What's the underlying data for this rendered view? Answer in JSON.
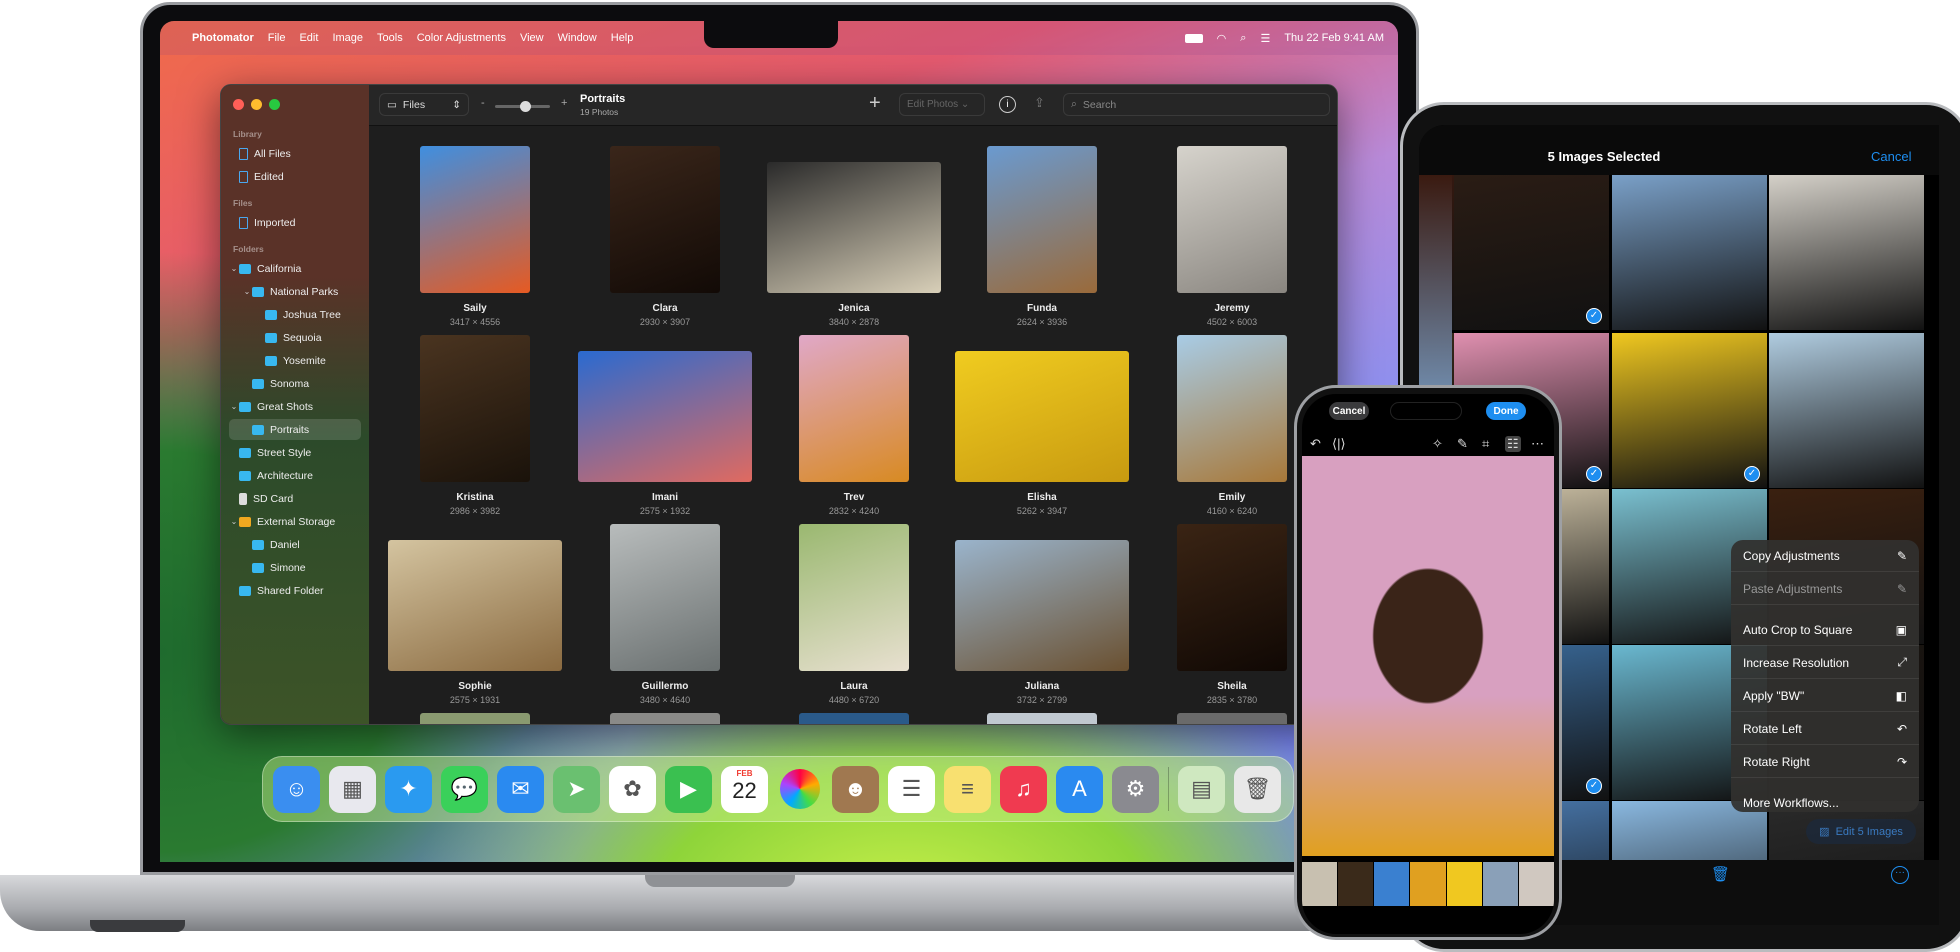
{
  "menubar": {
    "apple": "",
    "items": [
      "Photomator",
      "File",
      "Edit",
      "Image",
      "Tools",
      "Color Adjustments",
      "View",
      "Window",
      "Help"
    ],
    "datetime": "Thu 22 Feb  9:41 AM",
    "status_icons": [
      "battery-icon",
      "wifi-icon",
      "spotlight-search-icon",
      "control-center-icon"
    ]
  },
  "window": {
    "toolbar": {
      "source_select": "Files",
      "zoom_minus": "-",
      "zoom_plus": "+",
      "zoom_level": 0.55,
      "title": "Portraits",
      "subtitle": "19 Photos",
      "add": "+",
      "edit_photos": "Edit Photos ⌄",
      "search_placeholder": "Search"
    },
    "sidebar": {
      "sections": [
        {
          "header": "Library",
          "items": [
            {
              "label": "All Files",
              "icon": "doc",
              "level": 0
            },
            {
              "label": "Edited",
              "icon": "doc",
              "level": 0
            }
          ]
        },
        {
          "header": "Files",
          "items": [
            {
              "label": "Imported",
              "icon": "doc",
              "level": 0
            }
          ]
        },
        {
          "header": "Folders",
          "items": [
            {
              "label": "California",
              "icon": "folder",
              "level": 0,
              "chevron": "⌄"
            },
            {
              "label": "National Parks",
              "icon": "folder",
              "level": 1,
              "chevron": "⌄"
            },
            {
              "label": "Joshua Tree",
              "icon": "folder",
              "level": 2
            },
            {
              "label": "Sequoia",
              "icon": "folder",
              "level": 2
            },
            {
              "label": "Yosemite",
              "icon": "folder",
              "level": 2
            },
            {
              "label": "Sonoma",
              "icon": "folder",
              "level": 1
            },
            {
              "label": "Great Shots",
              "icon": "folder",
              "level": 0,
              "chevron": "⌄"
            },
            {
              "label": "Portraits",
              "icon": "folder",
              "level": 1,
              "selected": true
            },
            {
              "label": "Street Style",
              "icon": "folder",
              "level": 0
            },
            {
              "label": "Architecture",
              "icon": "folder",
              "level": 0
            },
            {
              "label": "SD Card",
              "icon": "card",
              "level": 0
            },
            {
              "label": "External Storage",
              "icon": "drive",
              "level": 0,
              "chevron": "⌄"
            },
            {
              "label": "Daniel",
              "icon": "folder",
              "level": 1
            },
            {
              "label": "Simone",
              "icon": "folder",
              "level": 1
            },
            {
              "label": "Shared Folder",
              "icon": "folder",
              "level": 0
            }
          ]
        }
      ]
    },
    "photos": [
      {
        "name": "Saily",
        "dims": "3417 × 4556",
        "colors": [
          "#3f8fe0",
          "#e65a22"
        ],
        "orient": "portrait"
      },
      {
        "name": "Clara",
        "dims": "2930 × 3907",
        "colors": [
          "#3a261a",
          "#120a06"
        ],
        "orient": "portrait"
      },
      {
        "name": "Jenica",
        "dims": "3840 × 2878",
        "colors": [
          "#2a2a2a",
          "#d8cfb8"
        ],
        "orient": "landscape"
      },
      {
        "name": "Funda",
        "dims": "2624 × 3936",
        "colors": [
          "#6a9ad0",
          "#9a6a3a"
        ],
        "orient": "portrait"
      },
      {
        "name": "Jeremy",
        "dims": "4502 × 6003",
        "colors": [
          "#d6d3cc",
          "#8a8680"
        ],
        "orient": "portrait"
      },
      {
        "name": "Kristina",
        "dims": "2986 × 3982",
        "colors": [
          "#4a3420",
          "#1a120a"
        ],
        "orient": "portrait"
      },
      {
        "name": "Imani",
        "dims": "2575 × 1932",
        "colors": [
          "#2a6ad0",
          "#e06a60"
        ],
        "orient": "landscape"
      },
      {
        "name": "Trev",
        "dims": "2832 × 4240",
        "colors": [
          "#e0a8c8",
          "#d88a22"
        ],
        "orient": "portrait"
      },
      {
        "name": "Elisha",
        "dims": "5262 × 3947",
        "colors": [
          "#f0cc20",
          "#c89a10"
        ],
        "orient": "landscape"
      },
      {
        "name": "Emily",
        "dims": "4160 × 6240",
        "colors": [
          "#a8cce6",
          "#a87838"
        ],
        "orient": "portrait"
      },
      {
        "name": "Sophie",
        "dims": "2575 × 1931",
        "colors": [
          "#d4c4a0",
          "#8a6a40"
        ],
        "orient": "landscape"
      },
      {
        "name": "Guillermo",
        "dims": "3480 × 4640",
        "colors": [
          "#b8bcbc",
          "#6a7070"
        ],
        "orient": "portrait"
      },
      {
        "name": "Laura",
        "dims": "4480 × 6720",
        "colors": [
          "#9ab870",
          "#e8e0d0"
        ],
        "orient": "portrait"
      },
      {
        "name": "Juliana",
        "dims": "3732 × 2799",
        "colors": [
          "#9ab4cc",
          "#6a5030"
        ],
        "orient": "landscape"
      },
      {
        "name": "Sheila",
        "dims": "2835 × 3780",
        "colors": [
          "#3a2414",
          "#100804"
        ],
        "orient": "portrait"
      }
    ],
    "partial_row_colors": [
      "#8a9a70",
      "#8a8a88",
      "#2a5a8a",
      "#c0c8d0",
      "#6a6a6a"
    ]
  },
  "dock": {
    "apps": [
      {
        "name": "finder",
        "glyph": "☺",
        "bg": "#3a8ef0"
      },
      {
        "name": "launchpad",
        "glyph": "▦",
        "bg": "#e8e8ee"
      },
      {
        "name": "safari",
        "glyph": "✦",
        "bg": "#2a9af0"
      },
      {
        "name": "messages",
        "glyph": "💬",
        "bg": "#3ad05a"
      },
      {
        "name": "mail",
        "glyph": "✉",
        "bg": "#2a8af0"
      },
      {
        "name": "maps",
        "glyph": "➤",
        "bg": "#6ac070"
      },
      {
        "name": "photos",
        "glyph": "✿",
        "bg": "#ffffff"
      },
      {
        "name": "facetime",
        "glyph": "▶",
        "bg": "#3ac050"
      },
      {
        "name": "calendar",
        "glyph": "",
        "bg": "#ffffff"
      },
      {
        "name": "photomator",
        "glyph": "●",
        "bg": "#2a2a2a"
      },
      {
        "name": "contacts",
        "glyph": "☻",
        "bg": "#a07850"
      },
      {
        "name": "reminders",
        "glyph": "☰",
        "bg": "#ffffff"
      },
      {
        "name": "notes",
        "glyph": "≡",
        "bg": "#f8e070"
      },
      {
        "name": "music",
        "glyph": "♫",
        "bg": "#f03a50"
      },
      {
        "name": "app-store",
        "glyph": "A",
        "bg": "#2a8af0"
      },
      {
        "name": "system-settings",
        "glyph": "⚙",
        "bg": "#8a8a90"
      },
      {
        "name": "photos-folder",
        "glyph": "▤",
        "bg": "#cfe8c0"
      },
      {
        "name": "trash",
        "glyph": "🗑",
        "bg": "#e8e8e8"
      }
    ],
    "calendar_month": "FEB",
    "calendar_day": "22"
  },
  "ipad": {
    "title": "5 Images Selected",
    "cancel": "Cancel",
    "tiles": [
      [
        "#3a1a10",
        "#2a1c14",
        "#7aa0c8",
        "#d4d0c8"
      ],
      [
        "#3a2a1a",
        "#e090b0",
        "#f0c820",
        "#b0cce0"
      ],
      [
        "#8aa070",
        "#d0c4a8",
        "#7ac0d0",
        "#3a2010"
      ],
      [
        "#1a1410",
        "#3a6a9a",
        "#6ab8d0",
        "#1a1410"
      ],
      [
        "#2a2a2a",
        "#4a7ab0",
        "#8ab8e0",
        "#2a2a2a"
      ]
    ],
    "checked": [
      [
        0,
        1
      ],
      [
        1,
        1
      ],
      [
        1,
        2
      ],
      [
        3,
        1
      ]
    ],
    "menu": [
      {
        "label": "Copy Adjustments",
        "icon": "eyedropper-icon",
        "glyph": "✎",
        "disabled": false
      },
      {
        "label": "Paste Adjustments",
        "icon": "eyedropper-fill-icon",
        "glyph": "✎",
        "disabled": true
      },
      {
        "label": "Auto Crop to Square",
        "icon": "crop-ml-icon",
        "glyph": "▣",
        "disabled": false
      },
      {
        "label": "Increase Resolution",
        "icon": "resolution-ml-icon",
        "glyph": "⤢",
        "disabled": false
      },
      {
        "label": "Apply \"BW\"",
        "icon": "preset-icon",
        "glyph": "◧",
        "disabled": false
      },
      {
        "label": "Rotate Left",
        "icon": "rotate-left-icon",
        "glyph": "↶",
        "disabled": false
      },
      {
        "label": "Rotate Right",
        "icon": "rotate-right-icon",
        "glyph": "↷",
        "disabled": false
      },
      {
        "label": "More Workflows...",
        "icon": "",
        "glyph": "",
        "disabled": false
      }
    ],
    "edit_button": "Edit 5 Images",
    "accent": "#1e8ef0"
  },
  "iphone": {
    "cancel": "Cancel",
    "done": "Done",
    "photo_colors": [
      "#d8a0c0",
      "#3a2418",
      "#e0a020"
    ],
    "filmstrip": [
      "#c8c0b0",
      "#3a2a1a",
      "#3a80d0",
      "#e0a020",
      "#f0c820",
      "#8aa0b8",
      "#d0c8c0"
    ]
  }
}
